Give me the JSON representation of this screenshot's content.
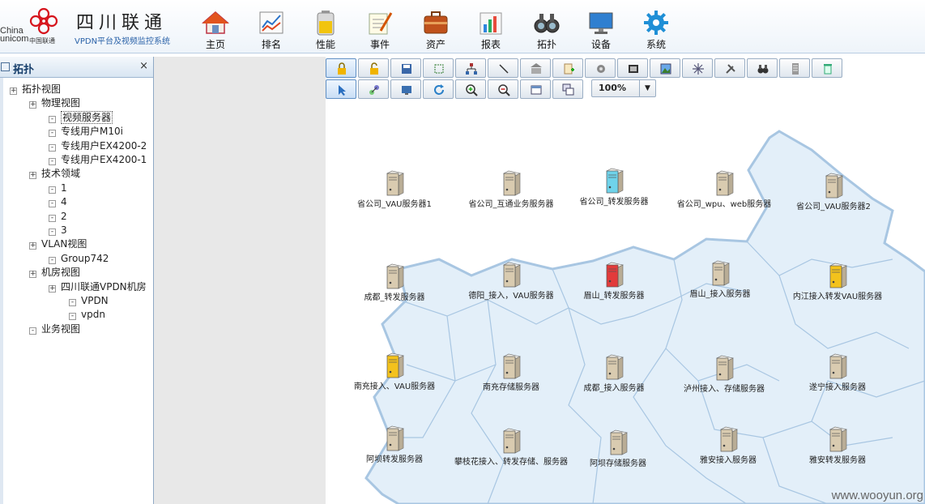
{
  "header": {
    "brand_latin": "China",
    "brand_latin2": "unicom",
    "brand_sub": "中国联通",
    "brand_name": "四川联通",
    "brand_tag": "VPDN平台及视频监控系统",
    "nav": [
      {
        "label": "主页",
        "icon": "home-icon"
      },
      {
        "label": "排名",
        "icon": "ranking-chart-icon"
      },
      {
        "label": "性能",
        "icon": "battery-icon"
      },
      {
        "label": "事件",
        "icon": "notepad-icon"
      },
      {
        "label": "资产",
        "icon": "briefcase-icon"
      },
      {
        "label": "报表",
        "icon": "bar-chart-icon"
      },
      {
        "label": "拓扑",
        "icon": "binoculars-icon"
      },
      {
        "label": "设备",
        "icon": "monitor-icon"
      },
      {
        "label": "系统",
        "icon": "gear-icon"
      }
    ]
  },
  "sidebar": {
    "title": "拓扑",
    "close": "×",
    "tree": [
      {
        "label": "拓扑视图",
        "toggle": "+"
      },
      {
        "label": "物理视图",
        "toggle": "+"
      },
      {
        "label": "视频服务器",
        "toggle": "-",
        "selected": true
      },
      {
        "label": "专线用户M10i",
        "toggle": "-"
      },
      {
        "label": "专线用户EX4200-2",
        "toggle": "-"
      },
      {
        "label": "专线用户EX4200-1",
        "toggle": "-"
      },
      {
        "label": "技术领域",
        "toggle": "+"
      },
      {
        "label": "1",
        "toggle": "-"
      },
      {
        "label": "4",
        "toggle": "-"
      },
      {
        "label": "2",
        "toggle": "-"
      },
      {
        "label": "3",
        "toggle": "-"
      },
      {
        "label": "VLAN视图",
        "toggle": "+"
      },
      {
        "label": "Group742",
        "toggle": "-"
      },
      {
        "label": "机房视图",
        "toggle": "+"
      },
      {
        "label": "四川联通VPDN机房",
        "toggle": "+"
      },
      {
        "label": "VPDN",
        "toggle": "-"
      },
      {
        "label": "vpdn",
        "toggle": "-"
      },
      {
        "label": "业务视图",
        "toggle": "-"
      }
    ]
  },
  "toolbar": {
    "row1": [
      "lock-icon",
      "unlock-icon",
      "save-icon",
      "select-area-icon",
      "hierarchy-icon",
      "line-icon",
      "building-icon",
      "add-node-icon",
      "settings-icon",
      "film-icon",
      "image-icon",
      "snowflake-icon",
      "tools-icon",
      "binoculars-icon",
      "rack-icon",
      "recycle-icon"
    ],
    "row2": [
      "pointer-icon",
      "link-icon",
      "screen-icon",
      "refresh-icon",
      "zoom-in-icon",
      "zoom-out-icon",
      "window-icon",
      "cascade-icon"
    ],
    "zoom": "100%"
  },
  "colors": {
    "normal": "#d9cbb0",
    "forwarding": "#6fd3ea",
    "alarm": "#e23b3b",
    "warning": "#f3c21c",
    "map_fill": "#e3eff9",
    "map_stroke": "#a8c6e2"
  },
  "servers": [
    {
      "label": "省公司_VAU服务器1",
      "status": "normal"
    },
    {
      "label": "省公司_互通业务服务器",
      "status": "normal"
    },
    {
      "label": "省公司_转发服务器",
      "status": "forwarding"
    },
    {
      "label": "省公司_wpu、web服务器",
      "status": "normal"
    },
    {
      "label": "省公司_VAU服务器2",
      "status": "normal"
    },
    {
      "label": "成都_转发服务器",
      "status": "normal"
    },
    {
      "label": "德阳_接入，VAU服务器",
      "status": "normal"
    },
    {
      "label": "眉山_转发服务器",
      "status": "alarm"
    },
    {
      "label": "眉山_接入服务器",
      "status": "normal"
    },
    {
      "label": "内江接入转发VAU服务器",
      "status": "warning"
    },
    {
      "label": "南充接入、VAU服务器",
      "status": "warning"
    },
    {
      "label": "南充存储服务器",
      "status": "normal"
    },
    {
      "label": "成都_接入服务器",
      "status": "normal"
    },
    {
      "label": "泸州接入、存储服务器",
      "status": "normal"
    },
    {
      "label": "遂宁接入服务器",
      "status": "normal"
    },
    {
      "label": "阿坝转发服务器",
      "status": "normal"
    },
    {
      "label": "攀枝花接入、转发存储、服务器",
      "status": "normal"
    },
    {
      "label": "阿坝存储服务器",
      "status": "normal"
    },
    {
      "label": "雅安接入服务器",
      "status": "normal"
    },
    {
      "label": "雅安转发服务器",
      "status": "normal"
    }
  ],
  "watermark": "www.wooyun.org"
}
